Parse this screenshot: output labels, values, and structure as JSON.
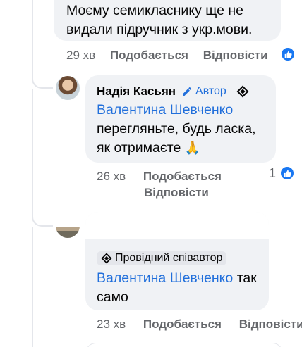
{
  "top_comment": {
    "text_line1": "Моєму семикласнику ще не",
    "text_line2": "видали підручник з укр.мови.",
    "time": "29 хв",
    "like_label": "Подобається",
    "reply_label": "Відповісти"
  },
  "reply1": {
    "author": "Надія Касьян",
    "author_badge": "Автор",
    "mention": "Валентина Шевченко",
    "text_line1": "перегляньте, будь ласка,",
    "text_line2": "як отримаєте",
    "emoji": "🙏",
    "time": "26 хв",
    "like_label": "Подобається",
    "reply_label": "Відповісти",
    "reaction_count": "1"
  },
  "reply2": {
    "badge": "Провідний співавтор",
    "mention": "Валентина Шевченко",
    "text_after_mention": "так",
    "text_line2": "само",
    "time": "23 хв",
    "like_label": "Подобається",
    "reply_label": "Відповісти"
  },
  "colors": {
    "accent": "#1877f2",
    "mention": "#216fdb",
    "bubble": "#f0f2f5",
    "meta": "#65676b"
  }
}
